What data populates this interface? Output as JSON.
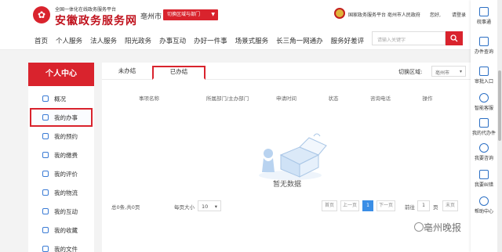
{
  "header": {
    "subtitle": "全国一体化在线政务服务平台",
    "site_name": "安徽政务服务网",
    "city": "亳州市",
    "switch_region": "切换区域与部门",
    "platform_text": "国家政务服务平台 亳州市人民政府",
    "greeting": "您好,",
    "login_text": "请登录"
  },
  "nav": {
    "items": [
      "首页",
      "个人服务",
      "法人服务",
      "阳光政务",
      "办事互动",
      "办好一件事",
      "场景式服务",
      "长三角一网通办",
      "服务好差评"
    ],
    "search_placeholder": "请输入关键字"
  },
  "sidebar": {
    "title": "个人中心",
    "items": [
      "概况",
      "我的办事",
      "我的预约",
      "我的缴费",
      "我的评价",
      "我的物流",
      "我的互动",
      "我的收藏",
      "我的文件"
    ],
    "active_index": 1
  },
  "main": {
    "tabs": [
      "未办结",
      "已办结"
    ],
    "active_tab": 1,
    "region_label": "切换区域:",
    "region_value": "亳州市",
    "columns": [
      "事项名称",
      "所属部门/主办部门",
      "申请时间",
      "状态",
      "咨询电话",
      "操作"
    ],
    "empty_text": "暂无数据"
  },
  "pager": {
    "info": "总0条,共0页",
    "per_page_label": "每页大小",
    "per_page_value": "10",
    "first": "首页",
    "prev": "上一页",
    "current": "1",
    "next": "下一页",
    "goto_prefix": "前往",
    "goto_value": "1",
    "goto_suffix": "页",
    "last": "末页"
  },
  "float_bar": {
    "items": [
      "皖事通",
      "办件查询",
      "审批入口",
      "智能客服",
      "我的代办件",
      "我要咨询",
      "我要纠错",
      "帮助中心"
    ]
  },
  "watermark": "亳州晚报",
  "colors": {
    "brand_red": "#d9232d",
    "accent_blue": "#3a8ee6"
  }
}
